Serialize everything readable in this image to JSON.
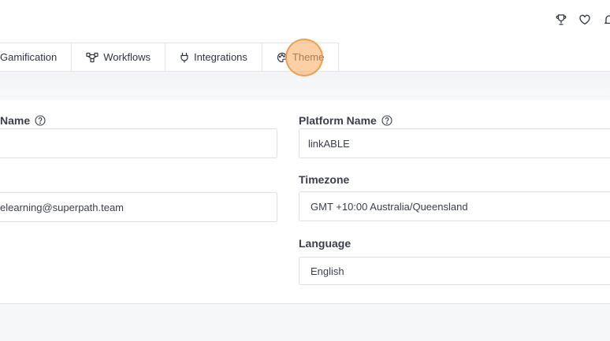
{
  "header": {
    "icons": [
      "trophy-icon",
      "heart-icon",
      "bell-icon"
    ]
  },
  "tabs": [
    {
      "label": "Gamification",
      "icon": ""
    },
    {
      "label": "Workflows",
      "icon": "workflow-icon"
    },
    {
      "label": "Integrations",
      "icon": "plug-icon"
    },
    {
      "label": "Theme",
      "icon": "palette-icon"
    }
  ],
  "form": {
    "left": {
      "name_label": "Name",
      "name_value": "",
      "email_value": "elearning@superpath.team"
    },
    "right": {
      "platform_name_label": "Platform Name",
      "platform_name_value": "linkABLE",
      "timezone_label": "Timezone",
      "timezone_value": "GMT +10:00 Australia/Queensland",
      "language_label": "Language",
      "language_value": "English"
    }
  },
  "colors": {
    "accent_ring": "#f6b068",
    "border": "#dcdfe4",
    "text": "#2f3441"
  }
}
